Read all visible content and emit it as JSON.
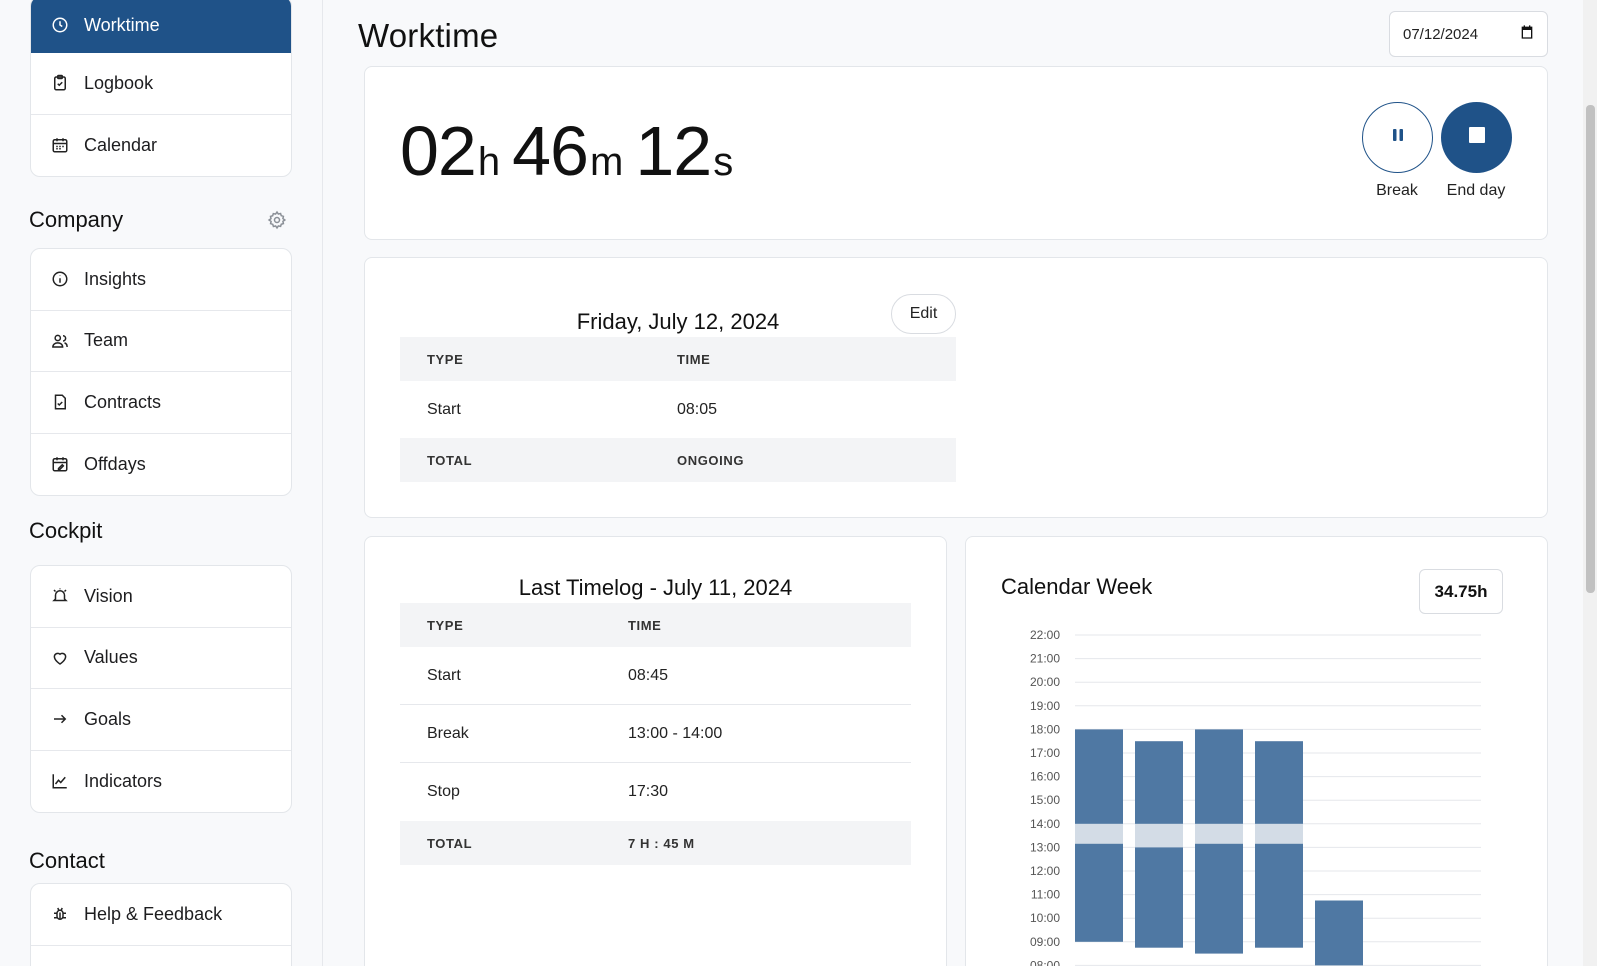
{
  "sidebar": {
    "top_items": [
      {
        "label": "Worktime",
        "icon": "clock-icon",
        "active": true
      },
      {
        "label": "Logbook",
        "icon": "clipboard-icon"
      },
      {
        "label": "Calendar",
        "icon": "calendar-icon"
      }
    ],
    "company": {
      "title": "Company",
      "items": [
        {
          "label": "Insights",
          "icon": "info-icon"
        },
        {
          "label": "Team",
          "icon": "users-icon"
        },
        {
          "label": "Contracts",
          "icon": "contract-icon"
        },
        {
          "label": "Offdays",
          "icon": "calendar-edit-icon"
        }
      ]
    },
    "cockpit": {
      "title": "Cockpit",
      "items": [
        {
          "label": "Vision",
          "icon": "alarm-icon"
        },
        {
          "label": "Values",
          "icon": "heart-icon"
        },
        {
          "label": "Goals",
          "icon": "arrow-right-icon"
        },
        {
          "label": "Indicators",
          "icon": "line-chart-icon"
        }
      ]
    },
    "contact": {
      "title": "Contact",
      "items": [
        {
          "label": "Help & Feedback",
          "icon": "bug-icon"
        }
      ]
    }
  },
  "header": {
    "title": "Worktime",
    "date_value": "07/12/2024"
  },
  "timer": {
    "hours": "02",
    "hours_unit": "h",
    "minutes": "46",
    "minutes_unit": "m",
    "seconds": "12",
    "seconds_unit": "s",
    "break_label": "Break",
    "end_label": "End day"
  },
  "today": {
    "title": "Friday, July 12, 2024",
    "edit_label": "Edit",
    "col_type": "TYPE",
    "col_time": "TIME",
    "rows": [
      {
        "type": "Start",
        "time": "08:05"
      }
    ],
    "total_label": "TOTAL",
    "total_value": "ONGOING"
  },
  "last_timelog": {
    "title": "Last Timelog - July 11, 2024",
    "col_type": "TYPE",
    "col_time": "TIME",
    "rows": [
      {
        "type": "Start",
        "time": "08:45"
      },
      {
        "type": "Break",
        "time": "13:00 - 14:00"
      },
      {
        "type": "Stop",
        "time": "17:30"
      }
    ],
    "total_label": "TOTAL",
    "total_value": "7 H : 45 M"
  },
  "calendar_week": {
    "title": "Calendar Week",
    "total": "34.75h"
  },
  "colors": {
    "accent": "#1f5288",
    "bar": "#4f78a3",
    "break_band": "#d3dce6"
  },
  "chart_data": {
    "type": "bar",
    "title": "Calendar Week",
    "y_ticks": [
      "22:00",
      "21:00",
      "20:00",
      "19:00",
      "18:00",
      "17:00",
      "16:00",
      "15:00",
      "14:00",
      "13:00",
      "12:00",
      "11:00",
      "10:00",
      "09:00",
      "08:00"
    ],
    "ylim": [
      8,
      22
    ],
    "series": [
      {
        "start": 9.0,
        "end": 18.0,
        "break_start": 13.7,
        "break_end": 14.0
      },
      {
        "start": 8.75,
        "end": 17.5,
        "break_start": 14.0,
        "break_end": 13.0
      },
      {
        "start": 8.5,
        "end": 18.0,
        "break_start": 13.7,
        "break_end": 14.0
      },
      {
        "start": 8.75,
        "end": 17.5,
        "break_start": 13.7,
        "break_end": 14.0
      },
      {
        "start": 8.0,
        "end": 10.75
      }
    ]
  }
}
